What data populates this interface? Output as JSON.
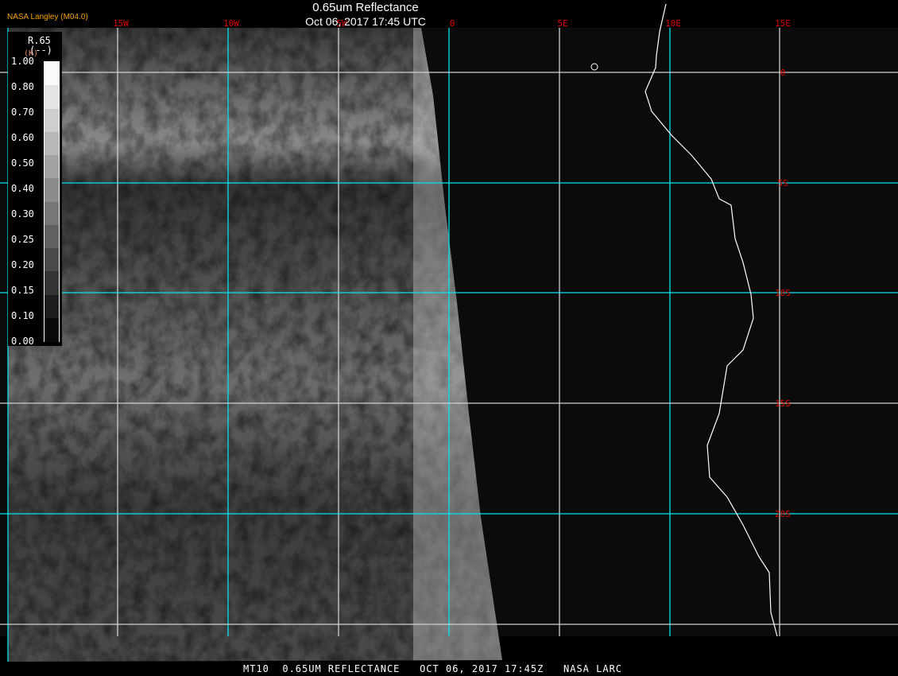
{
  "header": {
    "title": "0.65um Reflectance",
    "datetime": "Oct 06, 2017 17:45 UTC",
    "credit": "NASA Langley (M04.0)"
  },
  "footer": {
    "text": "MT10  0.65UM REFLECTANCE   OCT 06, 2017 17:45Z   NASA LARC"
  },
  "legend": {
    "name": "R.65",
    "units": "(--)",
    "unit_hint": "(K)",
    "ticks": [
      "1.00",
      "0.80",
      "0.70",
      "0.60",
      "0.50",
      "0.40",
      "0.30",
      "0.25",
      "0.20",
      "0.15",
      "0.10",
      "0.00"
    ]
  },
  "grid": {
    "lon_labels": [
      "15W",
      "10W",
      "5W",
      "0",
      "5E",
      "10E",
      "15E"
    ],
    "lat_labels": [
      "0",
      "5S",
      "10S",
      "15S",
      "20S"
    ]
  },
  "colors": {
    "grid_cyan": "#00e5f0",
    "grid_white": "#d0d0d0",
    "label_red": "#e00000",
    "credit": "#f0a000",
    "background": "#0b0b0b"
  }
}
